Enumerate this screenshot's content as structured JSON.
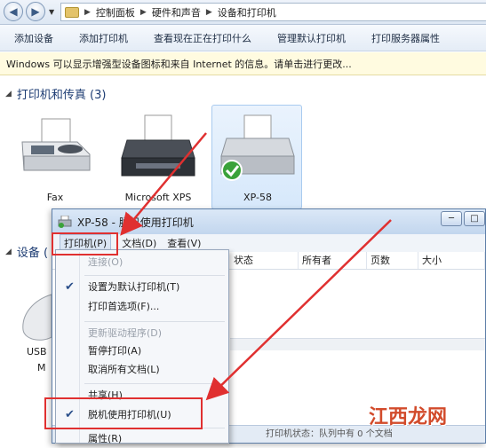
{
  "address_bar": {
    "crumbs": [
      "控制面板",
      "硬件和声音",
      "设备和打印机"
    ]
  },
  "toolbar": {
    "items": [
      "添加设备",
      "添加打印机",
      "查看现在正在打印什么",
      "管理默认打印机",
      "打印服务器属性"
    ]
  },
  "info_bar": {
    "text": "Windows 可以显示增强型设备图标和来自 Internet 的信息。请单击进行更改..."
  },
  "sections": {
    "printers_title": "打印机和传真 (3)",
    "devices_title": "设备 ("
  },
  "printers": [
    {
      "label": "Fax",
      "icon": "fax-icon"
    },
    {
      "label": "Microsoft XPS",
      "icon": "printer-icon"
    },
    {
      "label": "XP-58",
      "icon": "printer-default-icon"
    }
  ],
  "devices": [
    {
      "label_line1": "USB",
      "label_line2": "M"
    }
  ],
  "dialog": {
    "title": "XP-58 - 脱机使用打印机",
    "menus": [
      "打印机(P)",
      "文档(D)",
      "查看(V)"
    ],
    "columns": [
      "状态",
      "所有者",
      "页数",
      "大小"
    ],
    "status": "打印机状态：队列中有 0 个文档"
  },
  "printer_menu": {
    "items": [
      {
        "label": "连接(O)",
        "disabled": true,
        "checked": false
      },
      {
        "label": "设置为默认打印机(T)",
        "disabled": false,
        "checked": true
      },
      {
        "label": "打印首选项(F)...",
        "disabled": false,
        "checked": false
      },
      {
        "label": "更新驱动程序(D)",
        "disabled": true,
        "checked": false
      },
      {
        "label": "暂停打印(A)",
        "disabled": false,
        "checked": false
      },
      {
        "label": "取消所有文档(L)",
        "disabled": false,
        "checked": false
      },
      {
        "label": "共享(H)",
        "disabled": false,
        "checked": false
      },
      {
        "label": "脱机使用打印机(U)",
        "disabled": false,
        "checked": true
      },
      {
        "label": "属性(R)",
        "disabled": false,
        "checked": false
      }
    ]
  },
  "watermark": "江西龙网",
  "colors": {
    "highlight": "#e03030",
    "title_blue": "#1d3c73"
  }
}
